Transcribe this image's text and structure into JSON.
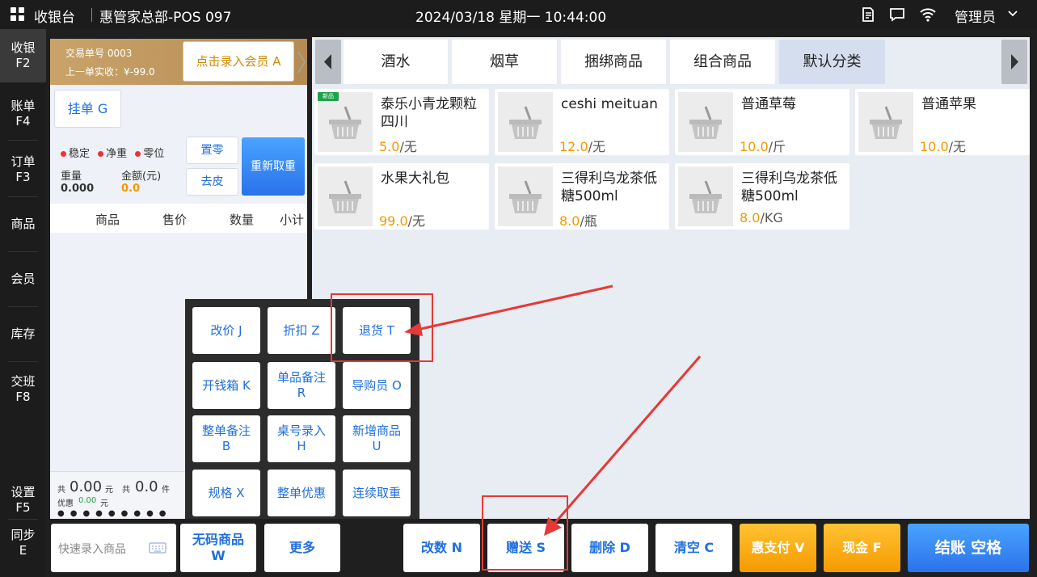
{
  "topbar": {
    "app_name": "收银台",
    "store": "惠管家总部-POS 097",
    "datetime": "2024/03/18 星期一 10:44:00",
    "user": "管理员"
  },
  "nav": {
    "cashier": {
      "label": "收银",
      "key": "F2"
    },
    "bills": {
      "label": "账单",
      "key": "F4"
    },
    "orders": {
      "label": "订单",
      "key": "F3"
    },
    "goods": {
      "label": "商品"
    },
    "members": {
      "label": "会员"
    },
    "stock": {
      "label": "库存"
    },
    "shift": {
      "label": "交班",
      "key": "F8"
    },
    "settings": {
      "label": "设置",
      "key": "F5"
    },
    "sync": {
      "label": "同步",
      "key": "E"
    }
  },
  "cart": {
    "trade_no": "交易单号 0003",
    "last_paid": "上一单实收：¥-99.0",
    "member_button": "点击录入会员 A",
    "hold_button": "挂单 G",
    "status": {
      "stable": "稳定",
      "net": "净重",
      "zero": "零位"
    },
    "weight_label": "重量",
    "weight_value": "0.000",
    "amount_label": "金额(元)",
    "amount_value": "0.0",
    "zero_button": "置零",
    "tare_button": "去皮",
    "reweigh_button": "重新取重",
    "columns": {
      "item": "商品",
      "price": "售价",
      "qty": "数量",
      "subtotal": "小计"
    },
    "footer": {
      "total_prefix": "共",
      "total_amount": "0.00",
      "total_unit": "元",
      "count_prefix": "共",
      "count": "0.0",
      "count_unit": "件",
      "discount_label": "优惠",
      "discount_value": "0.00",
      "discount_unit": "元"
    }
  },
  "categories": {
    "c1": "酒水",
    "c2": "烟草",
    "c3": "捆绑商品",
    "c4": "组合商品",
    "c5": "默认分类"
  },
  "products": {
    "p1": {
      "name": "泰乐小青龙颗粒四川",
      "price": "5.0",
      "unit": "/无",
      "tag": "新品"
    },
    "p2": {
      "name": "ceshi meituan",
      "price": "12.0",
      "unit": "/无"
    },
    "p3": {
      "name": "普通草莓",
      "price": "10.0",
      "unit": "/斤"
    },
    "p4": {
      "name": "普通苹果",
      "price": "10.0",
      "unit": "/无"
    },
    "p5": {
      "name": "水果大礼包",
      "price": "99.0",
      "unit": "/无"
    },
    "p6": {
      "name": "三得利乌龙茶低糖500ml",
      "price": "8.0",
      "unit": "/瓶"
    },
    "p7": {
      "name": "三得利乌龙茶低糖500ml",
      "price": "8.0",
      "unit": "/KG"
    }
  },
  "more_menu": {
    "change_price": "改价 J",
    "discount": "折扣 Z",
    "return": "退货 T",
    "cash_drawer": "开钱箱 K",
    "item_note": {
      "line1": "单品备注",
      "line2": "R"
    },
    "guide": "导购员 O",
    "order_note": {
      "line1": "整单备注",
      "line2": "B"
    },
    "table_no": {
      "line1": "桌号录入",
      "line2": "H"
    },
    "new_item": {
      "line1": "新增商品",
      "line2": "U"
    },
    "spec": "规格 X",
    "order_discount": "整单优惠",
    "continuous_weigh": "连续取重"
  },
  "bottom": {
    "quick_placeholder": "快速录入商品",
    "no_code": {
      "line1": "无码商品",
      "line2": "W"
    },
    "more": "更多",
    "change_qty": "改数 N",
    "gift": "赠送 S",
    "delete": "删除 D",
    "clear": "清空 C",
    "hui_pay": "惠支付 V",
    "cash": "现金 F",
    "checkout": "结账 空格"
  },
  "colors": {
    "accent_blue": "#1f6fe0",
    "price_orange": "#f39800",
    "annotation_red": "#e53935"
  }
}
